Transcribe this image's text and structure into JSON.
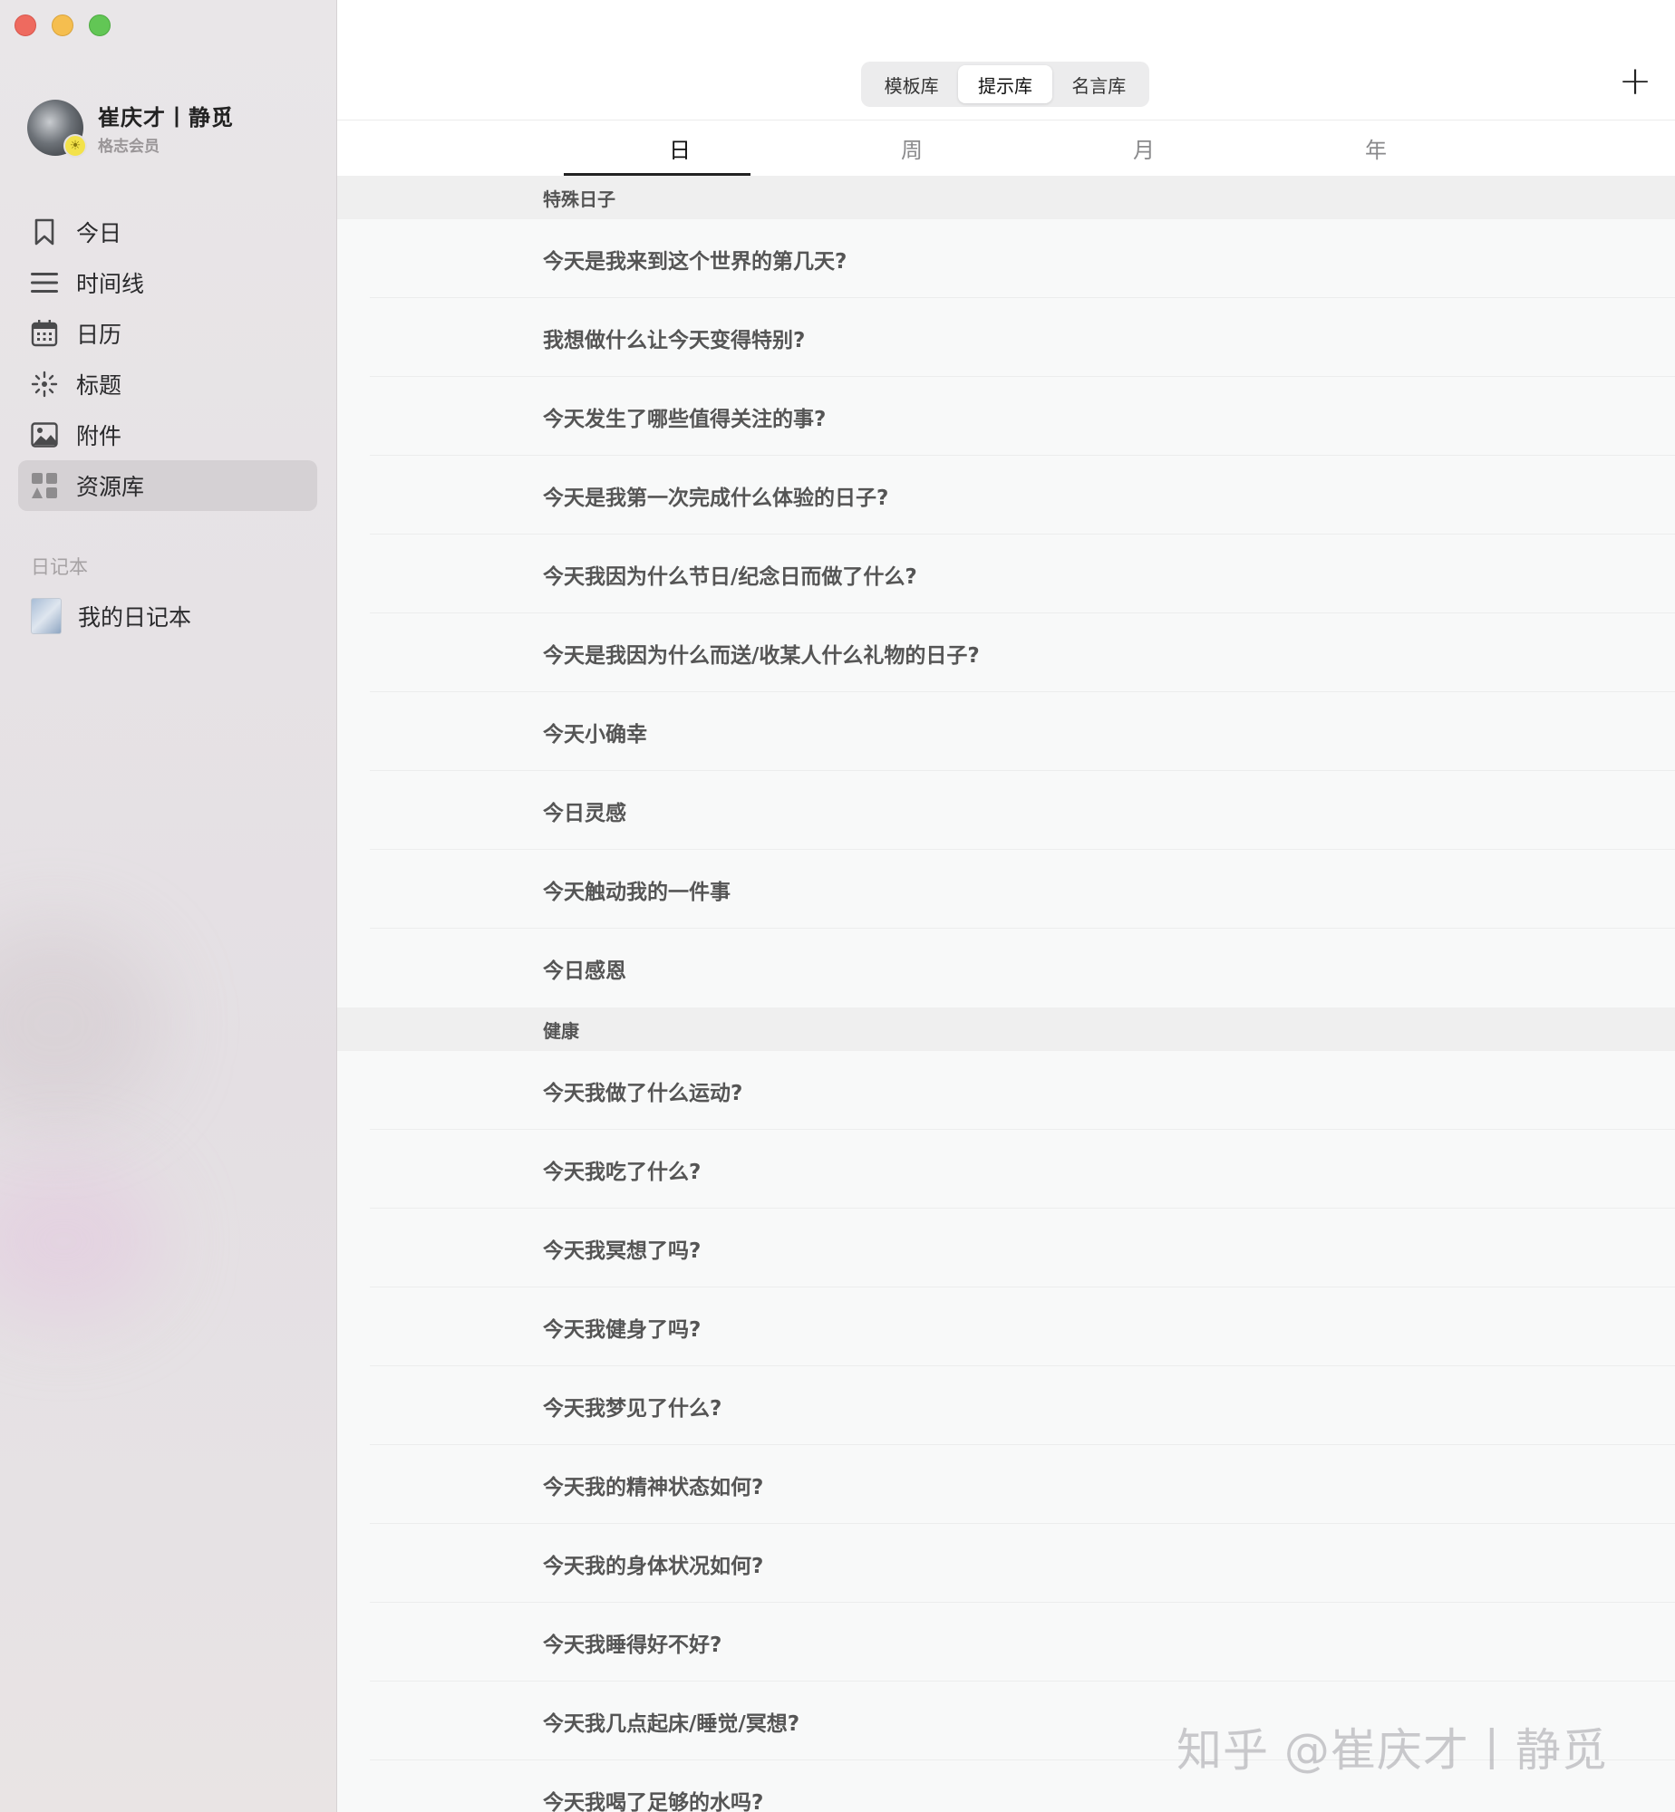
{
  "sidebar": {
    "profile": {
      "name": "崔庆才丨静觅",
      "member": "格志会员"
    },
    "nav": [
      {
        "label": "今日",
        "icon": "bookmark-icon"
      },
      {
        "label": "时间线",
        "icon": "list-icon"
      },
      {
        "label": "日历",
        "icon": "calendar-icon"
      },
      {
        "label": "标题",
        "icon": "sparkle-icon"
      },
      {
        "label": "附件",
        "icon": "image-icon"
      },
      {
        "label": "资源库",
        "icon": "grid-icon",
        "active": true
      }
    ],
    "section_label": "日记本",
    "notebooks": [
      {
        "label": "我的日记本"
      }
    ]
  },
  "toolbar": {
    "segments": [
      "模板库",
      "提示库",
      "名言库"
    ],
    "active_segment": "提示库",
    "add_icon": "plus-icon"
  },
  "tabs": [
    "日",
    "周",
    "月",
    "年"
  ],
  "active_tab": "日",
  "groups": [
    {
      "title": "特殊日子",
      "items": [
        "今天是我来到这个世界的第几天?",
        "我想做什么让今天变得特别?",
        "今天发生了哪些值得关注的事?",
        "今天是我第一次完成什么体验的日子?",
        "今天我因为什么节日/纪念日而做了什么?",
        "今天是我因为什么而送/收某人什么礼物的日子?",
        "今天小确幸",
        "今日灵感",
        "今天触动我的一件事",
        "今日感恩"
      ]
    },
    {
      "title": "健康",
      "items": [
        "今天我做了什么运动?",
        "今天我吃了什么?",
        "今天我冥想了吗?",
        "今天我健身了吗?",
        "今天我梦见了什么?",
        "今天我的精神状态如何?",
        "今天我的身体状况如何?",
        "今天我睡得好不好?",
        "今天我几点起床/睡觉/冥想?",
        "今天我喝了足够的水吗?"
      ]
    }
  ],
  "watermark": "知乎 @崔庆才丨静觅",
  "colors": {
    "accent": "#222222",
    "sidebar_bg": "#e6e2e5",
    "active_nav_bg": "#d5d1d4"
  }
}
